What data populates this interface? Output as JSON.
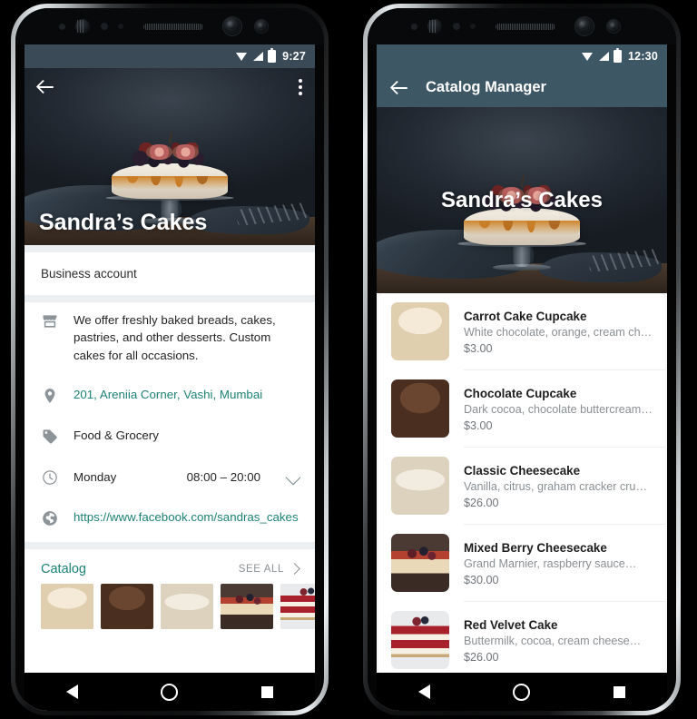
{
  "left_phone": {
    "status_bar": {
      "time": "9:27",
      "icons": [
        "wifi-icon",
        "signal-icon",
        "battery-icon"
      ]
    },
    "header": {
      "back_icon": "back-arrow-icon",
      "overflow_icon": "kebab-menu-icon"
    },
    "hero": {
      "title": "Sandra’s Cakes"
    },
    "business_account_label": "Business account",
    "info_rows": [
      {
        "icon": "storefront-icon",
        "text": "We offer freshly baked breads, cakes, pastries, and other desserts. Custom cakes for all occasions.",
        "is_link": false
      },
      {
        "icon": "location-pin-icon",
        "text": "201, Areniia Corner, Vashi, Mumbai",
        "is_link": true
      },
      {
        "icon": "tag-icon",
        "text": "Food & Grocery",
        "is_link": false
      },
      {
        "icon": "clock-icon",
        "text": "Monday",
        "value": "08:00 – 20:00",
        "chevron": "chevron-down-icon",
        "is_link": false
      },
      {
        "icon": "globe-icon",
        "text": "https://www.facebook.com/sandras_cakes",
        "is_link": true
      }
    ],
    "catalog": {
      "title": "Catalog",
      "see_all_label": "SEE ALL",
      "see_all_icon": "chevron-right-icon",
      "thumbnails": [
        {
          "name": "Carrot Cake Cupcake",
          "style": "img-carrot"
        },
        {
          "name": "Chocolate Cupcake",
          "style": "img-choc"
        },
        {
          "name": "Classic Cheesecake",
          "style": "img-classic"
        },
        {
          "name": "Mixed Berry Cheesecake",
          "style": "img-mixed"
        },
        {
          "name": "Red Velvet Cake",
          "style": "img-red"
        }
      ]
    },
    "nav_bar": {
      "back": "nav-back-icon",
      "home": "nav-home-icon",
      "recents": "nav-recents-icon"
    }
  },
  "right_phone": {
    "status_bar": {
      "time": "12:30",
      "icons": [
        "wifi-icon",
        "signal-icon",
        "battery-icon"
      ]
    },
    "app_bar": {
      "back_icon": "back-arrow-icon",
      "title": "Catalog Manager"
    },
    "hero": {
      "title": "Sandra’s Cakes"
    },
    "products": [
      {
        "name": "Carrot Cake Cupcake",
        "description": "White chocolate, orange, cream cheese…",
        "price": "$3.00",
        "style": "img-carrot"
      },
      {
        "name": "Chocolate Cupcake",
        "description": "Dark cocoa, chocolate buttercream…",
        "price": "$3.00",
        "style": "img-choc"
      },
      {
        "name": "Classic Cheesecake",
        "description": "Vanilla, citrus, graham cracker crust…",
        "price": "$26.00",
        "style": "img-classic"
      },
      {
        "name": "Mixed Berry Cheesecake",
        "description": "Grand Marnier, raspberry sauce…",
        "price": "$30.00",
        "style": "img-mixed"
      },
      {
        "name": "Red Velvet Cake",
        "description": "Buttermilk, cocoa, cream cheese…",
        "price": "$26.00",
        "style": "img-red"
      }
    ],
    "nav_bar": {
      "back": "nav-back-icon",
      "home": "nav-home-icon",
      "recents": "nav-recents-icon"
    }
  },
  "colors": {
    "accent_green": "#1d8274",
    "app_bar": "#3e5764",
    "status_bar_left": "#3a4a57",
    "page_background": "#000000"
  }
}
